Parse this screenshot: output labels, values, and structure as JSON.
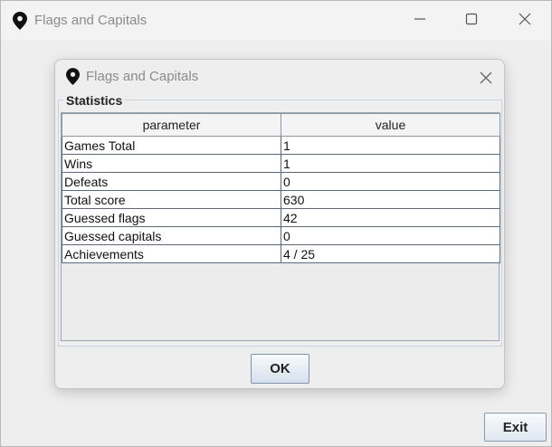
{
  "main_window": {
    "title": "Flags and Capitals",
    "icon": "map-pin-icon",
    "controls": [
      "minimize-icon",
      "maximize-icon",
      "close-icon"
    ],
    "exit_label": "Exit"
  },
  "dialog": {
    "title": "Flags and Capitals",
    "icon": "map-pin-icon",
    "group_title": "Statistics",
    "columns": [
      "parameter",
      "value"
    ],
    "rows": [
      [
        "Games Total",
        "1"
      ],
      [
        "Wins",
        "1"
      ],
      [
        "Defeats",
        "0"
      ],
      [
        "Total score",
        "630"
      ],
      [
        "Guessed flags",
        "42"
      ],
      [
        "Guessed capitals",
        "0"
      ],
      [
        "Achievements",
        "4 / 25"
      ]
    ],
    "ok_label": "OK"
  }
}
